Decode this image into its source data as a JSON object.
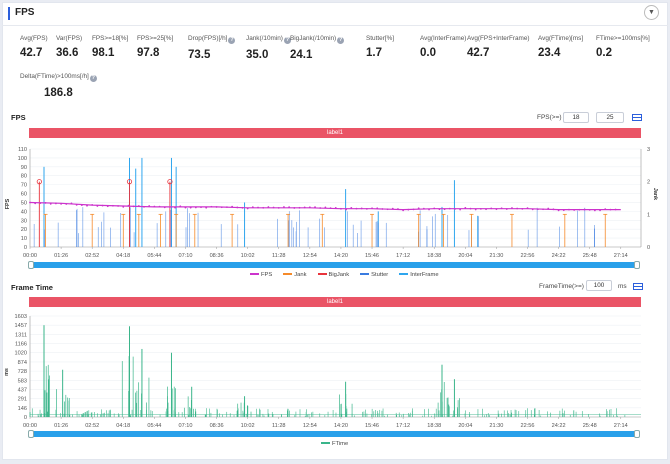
{
  "header": {
    "title": "FPS",
    "collapse_icon": "chevron-down-icon"
  },
  "metrics": [
    {
      "label": "Avg(FPS)",
      "value": "42.7",
      "help": false
    },
    {
      "label": "Var(FPS)",
      "value": "36.6",
      "help": false
    },
    {
      "label": "FPS>=18[%]",
      "value": "98.1",
      "help": false
    },
    {
      "label": "FPS>=25[%]",
      "value": "97.8",
      "help": false
    },
    {
      "label": "Drop(FPS)[/h]",
      "value": "73.5",
      "help": true
    },
    {
      "label": "Jank(/10min)",
      "value": "35.0",
      "help": true
    },
    {
      "label": "BigJank(/10min)",
      "value": "24.1",
      "help": true
    },
    {
      "label": "Stutter[%]",
      "value": "1.7",
      "help": false
    },
    {
      "label": "Avg(InterFrame)",
      "value": "0.0",
      "help": false
    },
    {
      "label": "Avg(FPS+InterFrame)",
      "value": "42.7",
      "help": false
    },
    {
      "label": "Avg(FTime)[ms]",
      "value": "23.4",
      "help": false
    },
    {
      "label": "FTime>=100ms[%]",
      "value": "0.2",
      "help": false
    },
    {
      "label": "Delta(FTime)>100ms[/h]",
      "value": "186.8",
      "help": true
    }
  ],
  "fps_section": {
    "title": "FPS",
    "threshold_label": "FPS(>=)",
    "threshold_1": "18",
    "threshold_2": "25",
    "table_icon": "table-icon",
    "banner": "label1",
    "legend": [
      "FPS",
      "Jank",
      "BigJank",
      "Stutter",
      "InterFrame"
    ]
  },
  "frametime_section": {
    "title": "Frame Time",
    "threshold_label": "FrameTime(>=)",
    "threshold": "100",
    "unit": "ms",
    "table_icon": "table-icon",
    "banner": "label1",
    "legend": [
      "FTime"
    ]
  },
  "colors": {
    "accent": "#2c5fdc",
    "fps": "#cc33cc",
    "jank": "#f58a2a",
    "bigjank": "#e8343c",
    "stutter": "#3a7be0",
    "interframe": "#2fa6ee",
    "ftime": "#3ab58a",
    "banner": "#ea5466"
  },
  "chart_data": [
    {
      "type": "line",
      "title": "FPS",
      "x_ticks": [
        "00:00",
        "01:26",
        "02:52",
        "04:18",
        "05:44",
        "07:10",
        "08:36",
        "10:02",
        "11:28",
        "12:54",
        "14:20",
        "15:46",
        "17:12",
        "18:38",
        "20:04",
        "21:30",
        "22:56",
        "24:22",
        "25:48",
        "27:14"
      ],
      "ylim": [
        0,
        110
      ],
      "y_ticks": [
        0,
        10,
        20,
        30,
        40,
        50,
        60,
        70,
        80,
        90,
        100,
        110
      ],
      "ylabel": "FPS",
      "y2lim": [
        0,
        3
      ],
      "y2_ticks": [
        0,
        1,
        2,
        3
      ],
      "y2label": "Jank",
      "series": [
        {
          "name": "FPS",
          "x": [
            0,
            1,
            2,
            3,
            4,
            5,
            6,
            7,
            8,
            9,
            10,
            11,
            12,
            13,
            14,
            15,
            16,
            17,
            18,
            19
          ],
          "values": [
            50,
            49,
            47,
            46,
            45,
            45,
            45,
            44,
            44,
            44,
            43,
            43,
            42,
            43,
            43,
            43,
            43,
            42,
            42,
            42
          ]
        },
        {
          "name": "Jank",
          "x": [
            0.5,
            2,
            3,
            3.5,
            4.2,
            4.7,
            5.3,
            6.5,
            8.3,
            9.4,
            11,
            12.5,
            13.3,
            14.2,
            15.5,
            17.2,
            18.5
          ],
          "values": [
            1,
            1,
            1,
            1,
            1,
            1,
            1,
            1,
            1,
            1,
            1,
            1,
            1,
            1,
            1,
            1,
            1
          ]
        },
        {
          "name": "BigJank",
          "x": [
            0.3,
            3.2,
            4.5
          ],
          "values": [
            2,
            2,
            2
          ]
        }
      ]
    },
    {
      "type": "bar",
      "title": "Frame Time",
      "x_ticks": [
        "00:00",
        "01:26",
        "02:52",
        "04:18",
        "05:44",
        "07:10",
        "08:36",
        "10:02",
        "11:28",
        "12:54",
        "14:20",
        "15:46",
        "17:12",
        "18:38",
        "20:04",
        "21:30",
        "22:56",
        "24:22",
        "25:48",
        "27:14"
      ],
      "ylim": [
        0,
        1603
      ],
      "y_ticks": [
        0,
        146,
        291,
        437,
        583,
        728,
        874,
        1020,
        1166,
        1311,
        1457,
        1603
      ],
      "ylabel": "ms",
      "series": [
        {
          "name": "FTime",
          "x": [
            0.45,
            1.05,
            3.2,
            3.6,
            4.55,
            5.2,
            6.9,
            10.15,
            13.25,
            13.65
          ],
          "values": [
            1457,
            750,
            1440,
            1080,
            1020,
            480,
            330,
            560,
            830,
            600
          ]
        }
      ]
    }
  ]
}
